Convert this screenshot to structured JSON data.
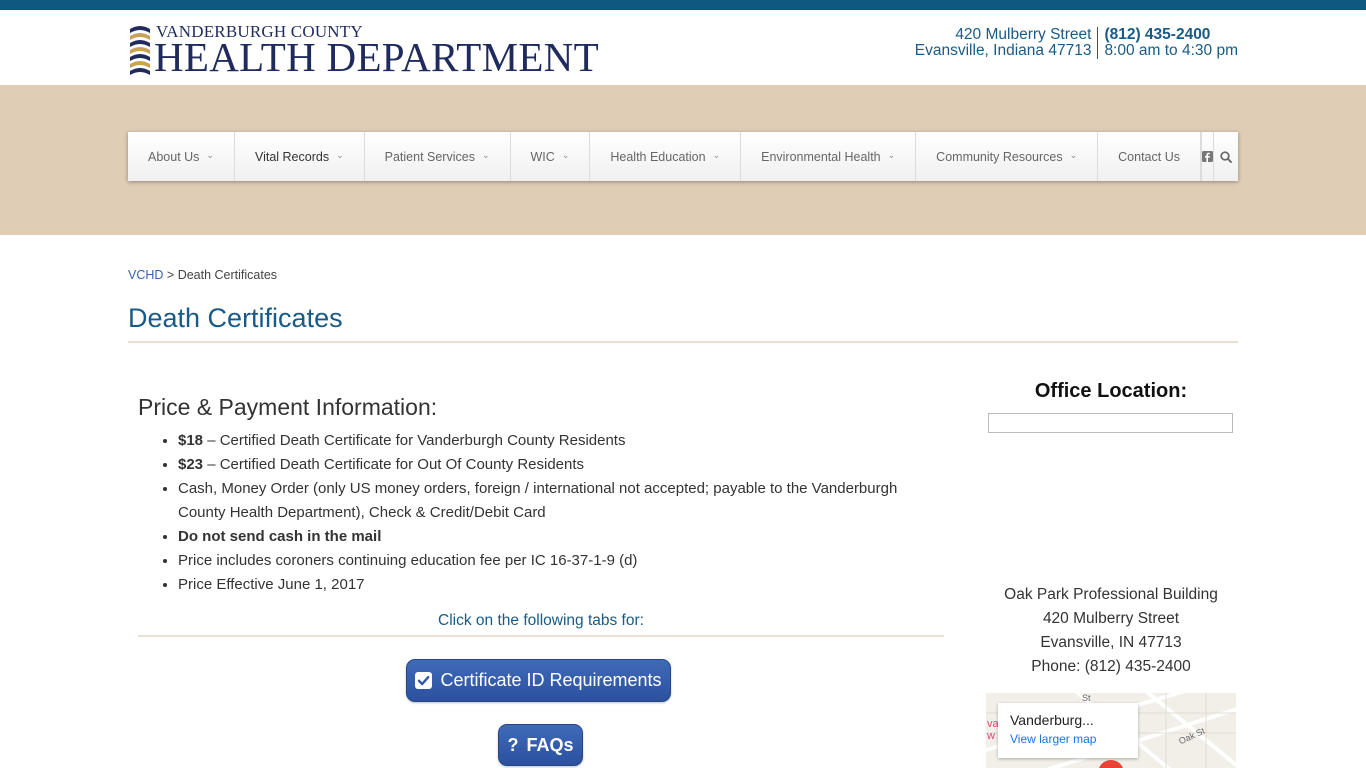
{
  "header": {
    "logo_county": "VANDERBURGH COUNTY",
    "logo_dept": "HEALTH DEPARTMENT",
    "address_line1": "420 Mulberry Street",
    "address_line2": "Evansville, Indiana 47713",
    "phone": "(812) 435-2400",
    "hours": "8:00 am to 4:30 pm"
  },
  "nav": {
    "items": [
      {
        "label": "About Us"
      },
      {
        "label": "Vital Records"
      },
      {
        "label": "Patient Services"
      },
      {
        "label": "WIC"
      },
      {
        "label": "Health Education"
      },
      {
        "label": "Environmental Health"
      },
      {
        "label": "Community Resources"
      },
      {
        "label": "Contact Us"
      }
    ],
    "facebook_icon": "facebook-icon",
    "search_icon": "search-icon"
  },
  "breadcrumb": {
    "home": "VCHD",
    "separator": ">",
    "current": "Death Certificates"
  },
  "page": {
    "title": "Death Certificates"
  },
  "main": {
    "heading": "Price & Payment Information:",
    "items": [
      {
        "bold": "$18",
        "text": " – Certified Death Certificate for Vanderburgh County Residents"
      },
      {
        "bold": "$23",
        "text": " – Certified Death Certificate for Out Of County Residents"
      },
      {
        "bold": "",
        "text": "Cash, Money Order (only US money orders, foreign / international not accepted; payable to the Vanderburgh County Health Department), Check & Credit/Debit Card"
      },
      {
        "bold": "Do not send cash in the mail",
        "text": ""
      },
      {
        "bold": "",
        "text": "Price includes coroners continuing education fee per IC 16-37-1-9 (d)"
      },
      {
        "bold": "",
        "text": "Price Effective June 1, 2017"
      }
    ],
    "click_note": "Click on the following tabs for:",
    "cert_button": "Certificate ID Requirements",
    "faq_button": "FAQs"
  },
  "sidebar": {
    "heading": "Office Location:",
    "building": "Oak Park Professional Building",
    "street": "420 Mulberry Street",
    "city": "Evansville, IN 47713",
    "phone": "Phone: (812) 435-2400",
    "map_name": "Vanderburg...",
    "map_link": "View larger map",
    "map_street_oak": "Oak St"
  },
  "colors": {
    "topbar": "#0e5a7e",
    "band": "#dfcdb5",
    "link_blue": "#1a5a86",
    "button_blue": "#2f58a8"
  }
}
